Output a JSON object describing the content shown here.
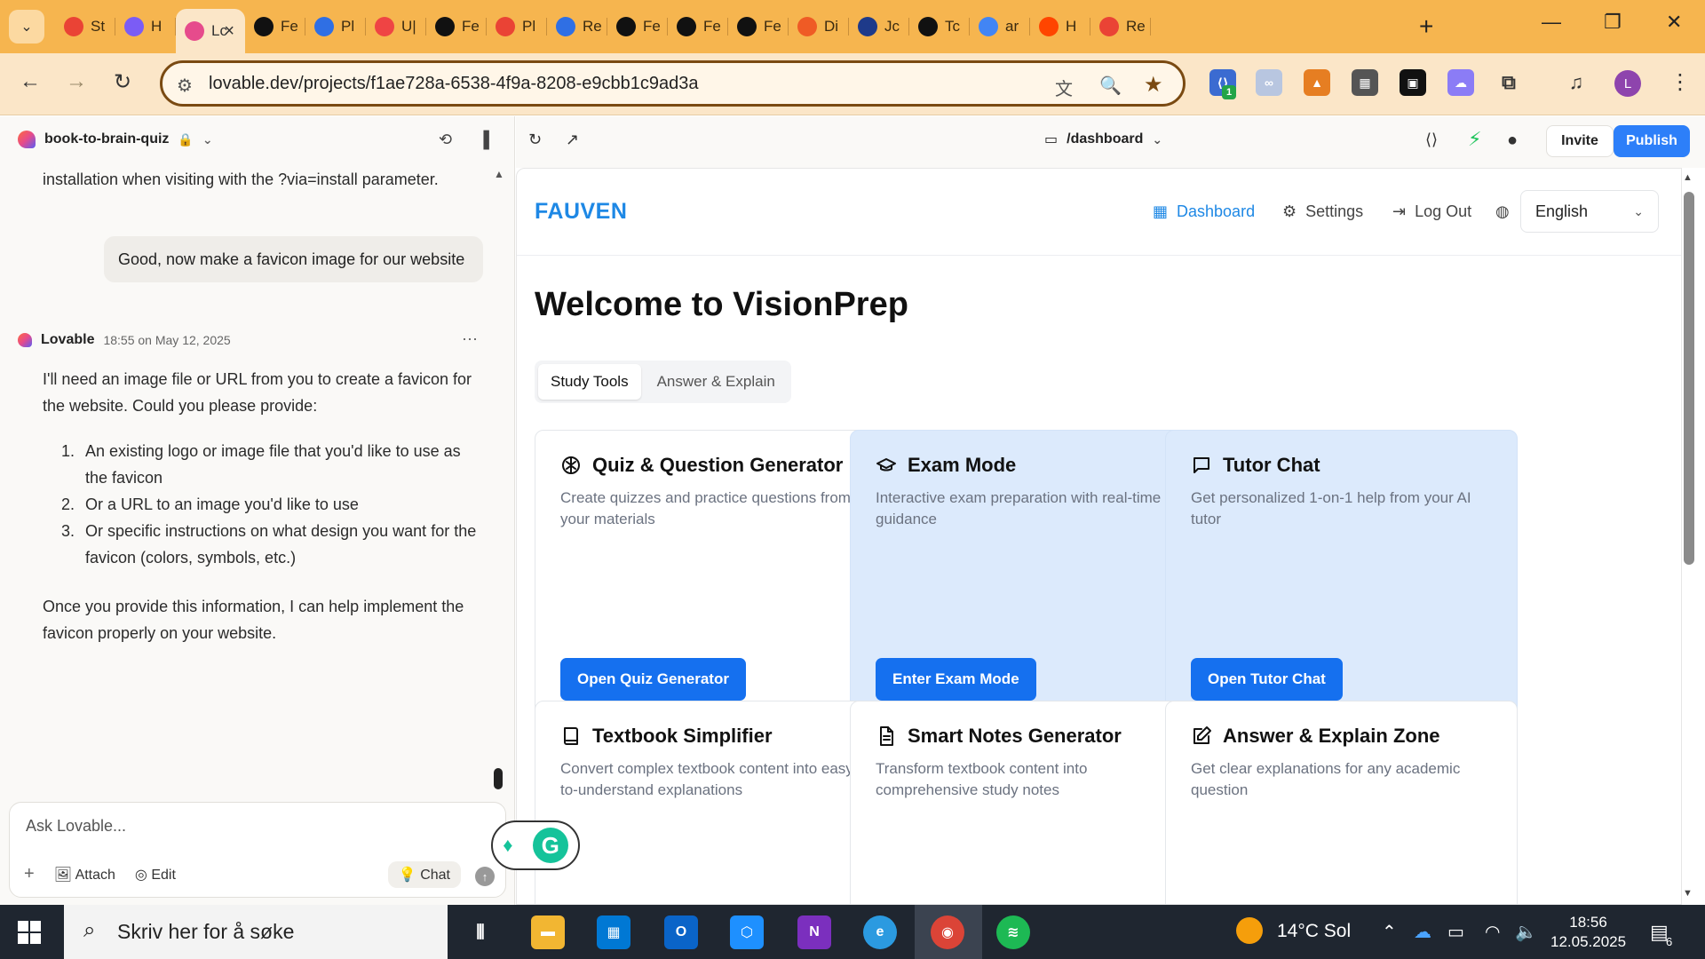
{
  "browser": {
    "tabs": [
      {
        "label": "St",
        "icon": "gmail-icon",
        "color": "#ea4335"
      },
      {
        "label": "H",
        "icon": "s-app-icon",
        "color": "#7b5cf5"
      },
      {
        "label": "Lc",
        "icon": "lovable-icon",
        "color": "#e64b8c",
        "active": true
      },
      {
        "label": "Fe",
        "icon": "openai-icon",
        "color": "#111111"
      },
      {
        "label": "Pl",
        "icon": "ring-icon",
        "color": "#2f6fe4"
      },
      {
        "label": "U|",
        "icon": "puzzle-icon",
        "color": "#ef4444"
      },
      {
        "label": "Fe",
        "icon": "heart-icon",
        "color": "#111111"
      },
      {
        "label": "Pl",
        "icon": "gmail-icon",
        "color": "#ea4335"
      },
      {
        "label": "Re",
        "icon": "ring-icon",
        "color": "#2f6fe4"
      },
      {
        "label": "Fe",
        "icon": "heart-icon",
        "color": "#111111"
      },
      {
        "label": "Fe",
        "icon": "heart-icon",
        "color": "#111111"
      },
      {
        "label": "Fe",
        "icon": "heart-icon",
        "color": "#111111"
      },
      {
        "label": "Di",
        "icon": "u-app-icon",
        "color": "#ef5b25"
      },
      {
        "label": "Jc",
        "icon": "nrk-icon",
        "color": "#1e3a8a"
      },
      {
        "label": "Tc",
        "icon": "openai-icon",
        "color": "#111111"
      },
      {
        "label": "ar",
        "icon": "google-icon",
        "color": "#4285f4"
      },
      {
        "label": "H",
        "icon": "reddit-icon",
        "color": "#ff4500"
      },
      {
        "label": "Re",
        "icon": "gmail-icon",
        "color": "#ea4335"
      }
    ],
    "url": "lovable.dev/projects/f1ae728a-6538-4f9a-8208-e9cbb1c9ad3a",
    "profile_initial": "L",
    "ext_badge": "1"
  },
  "lovable": {
    "project_name": "book-to-brain-quiz",
    "prev_text": "installation when visiting with the ?via=install parameter.",
    "user_message": "Good, now make a favicon image for our website",
    "assistant": {
      "name": "Lovable",
      "time": "18:55 on May 12, 2025",
      "intro": "I'll need an image file or URL from you to create a favicon for the website. Could you please provide:",
      "steps": [
        {
          "num": "1.",
          "text": "An existing logo or image file that you'd like to use as the favicon"
        },
        {
          "num": "2.",
          "text": "Or a URL to an image you'd like to use"
        },
        {
          "num": "3.",
          "text": "Or specific instructions on what design you want for the favicon (colors, symbols, etc.)"
        }
      ],
      "outro": "Once you provide this information, I can help implement the favicon properly on your website."
    },
    "composer": {
      "placeholder": "Ask Lovable...",
      "attach": "Attach",
      "edit": "Edit",
      "chat": "Chat"
    },
    "route": "/dashboard",
    "invite": "Invite",
    "publish": "Publish"
  },
  "app": {
    "brand": "FAUVEN",
    "nav": {
      "dashboard": "Dashboard",
      "settings": "Settings",
      "logout": "Log Out",
      "language": "English"
    },
    "welcome": "Welcome to VisionPrep",
    "tabs": [
      "Study Tools",
      "Answer & Explain"
    ],
    "cards": [
      {
        "title": "Quiz & Question Generator",
        "desc": "Create quizzes and practice questions from your materials",
        "cta": "Open Quiz Generator",
        "icon": "brain-icon",
        "highlight": false
      },
      {
        "title": "Exam Mode",
        "desc": "Interactive exam preparation with real-time guidance",
        "cta": "Enter Exam Mode",
        "icon": "graduation-cap-icon",
        "highlight": true
      },
      {
        "title": "Tutor Chat",
        "desc": "Get personalized 1-on-1 help from your AI tutor",
        "cta": "Open Tutor Chat",
        "icon": "message-square-icon",
        "highlight": true
      },
      {
        "title": "Textbook Simplifier",
        "desc": "Convert complex textbook content into easy-to-understand explanations",
        "icon": "book-icon",
        "highlight": false
      },
      {
        "title": "Smart Notes Generator",
        "desc": "Transform textbook content into comprehensive study notes",
        "icon": "file-text-icon",
        "highlight": false
      },
      {
        "title": "Answer & Explain Zone",
        "desc": "Get clear explanations for any academic question",
        "icon": "pen-square-icon",
        "highlight": false
      }
    ]
  },
  "taskbar": {
    "search_placeholder": "Skriv her for å søke",
    "weather": "14°C  Sol",
    "time": "18:56",
    "date": "12.05.2025",
    "notifications": "6"
  }
}
